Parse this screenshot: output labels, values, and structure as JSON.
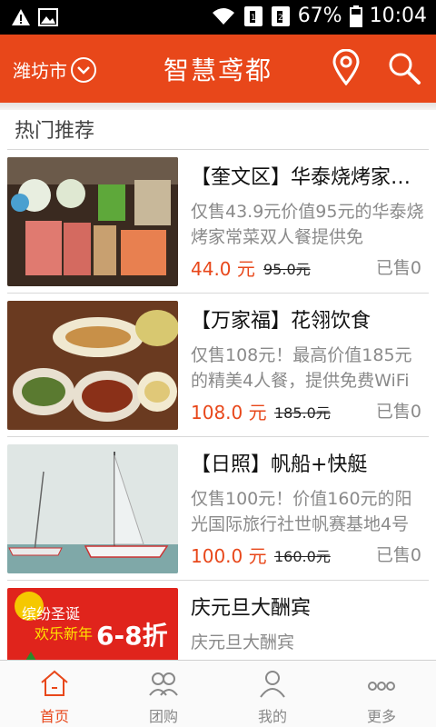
{
  "status": {
    "battery": "67%",
    "time": "10:04"
  },
  "header": {
    "city": "潍坊市",
    "title": "智慧鸢都"
  },
  "section": {
    "title": "热门推荐"
  },
  "items": [
    {
      "title": "【奎文区】华泰烧烤家常菜",
      "desc": "仅售43.9元价值95元的华泰烧烤家常菜双人餐提供免",
      "price": "44.0 元",
      "orig": "95.0元",
      "sold": "已售0",
      "image": "bbq-skewers-photo"
    },
    {
      "title": "【万家福】花翎饮食",
      "desc": "仅售108元！最高价值185元的精美4人餐，提供免费WiFi",
      "price": "108.0 元",
      "orig": "185.0元",
      "sold": "已售0",
      "image": "dishes-photo"
    },
    {
      "title": "【日照】帆船+快艇",
      "desc": "仅售100元！价值160元的阳光国际旅行社世帆赛基地4号",
      "price": "100.0 元",
      "orig": "160.0元",
      "sold": "已售0",
      "image": "sailboat-photo"
    },
    {
      "title": "庆元旦大酬宾",
      "desc": "庆元旦大酬宾",
      "price": "",
      "orig": "",
      "sold": "",
      "image": "new-year-promo",
      "image_text": {
        "line1": "缤纷圣诞",
        "line2": "欢乐新年",
        "discount": "6-8折"
      }
    }
  ],
  "tabs": [
    {
      "label": "首页",
      "icon": "home-icon",
      "active": true
    },
    {
      "label": "团购",
      "icon": "group-icon",
      "active": false
    },
    {
      "label": "我的",
      "icon": "user-icon",
      "active": false
    },
    {
      "label": "更多",
      "icon": "more-icon",
      "active": false
    }
  ],
  "colors": {
    "accent": "#e8471a"
  }
}
